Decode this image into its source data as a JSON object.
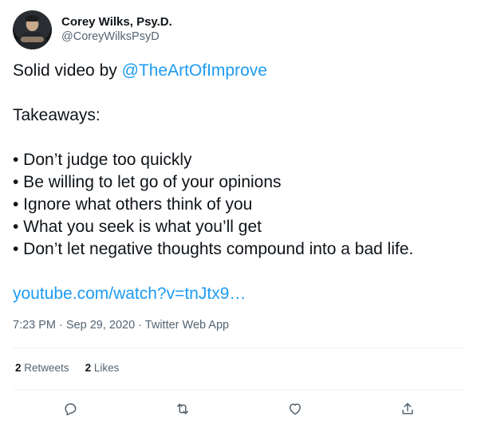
{
  "author": {
    "display_name": "Corey Wilks, Psy.D.",
    "handle": "@CoreyWilksPsyD"
  },
  "tweet": {
    "intro_text": "Solid video by ",
    "mention": "@TheArtOfImprove",
    "heading": "Takeaways:",
    "bullets": [
      "• Don’t judge too quickly",
      "• Be willing to let go of your opinions",
      "• Ignore what others think of you",
      "• What you seek is what you’ll get",
      "• Don’t let negative thoughts compound into a bad life."
    ],
    "link": "youtube.com/watch?v=tnJtx9…"
  },
  "meta": {
    "time": "7:23 PM",
    "separator1": " · ",
    "date": "Sep 29, 2020",
    "separator2": " · ",
    "source": "Twitter Web App"
  },
  "stats": {
    "retweets_count": "2",
    "retweets_label": "Retweets",
    "likes_count": "2",
    "likes_label": "Likes"
  },
  "actions": {
    "reply": "reply-icon",
    "retweet": "retweet-icon",
    "like": "heart-icon",
    "share": "share-icon"
  },
  "colors": {
    "link": "#1d9bf0",
    "text": "#0f1419",
    "secondary": "#536471",
    "divider": "#eff3f4"
  }
}
